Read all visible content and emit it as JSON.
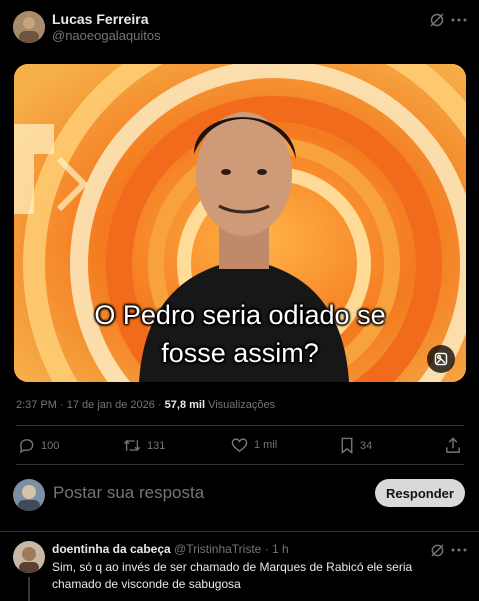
{
  "post": {
    "author_name": "Lucas Ferreira",
    "author_handle": "@naoeogalaquitos",
    "caption_line1": "O Pedro seria odiado se",
    "caption_line2": "fosse assim?",
    "time": "2:37 PM",
    "sep": "·",
    "date": "17 de jan de 2026",
    "views_count": "57,8 mil",
    "views_label": "Visualizações",
    "replies": "100",
    "reposts": "131",
    "likes": "1 mil",
    "bookmarks": "34"
  },
  "composer": {
    "placeholder": "Postar sua resposta",
    "button_label": "Responder"
  },
  "reply": {
    "author_name": "doentinha da cabeça",
    "author_handle": "@TristinhaTriste",
    "time": "· 1 h",
    "text_line1": "Sim, só q ao invés de ser chamado de Marques de Rabicó ele seria",
    "text_line2": "chamado de visconde de sabugosa"
  },
  "colors": {
    "background": "#000000",
    "muted": "#71767b",
    "text": "#e7e9ea",
    "button_bg": "#d9d9d9"
  },
  "icons": [
    "grok-icon",
    "more-icon",
    "reply-icon",
    "repost-icon",
    "like-icon",
    "bookmark-icon",
    "share-icon",
    "media-edit-icon"
  ]
}
